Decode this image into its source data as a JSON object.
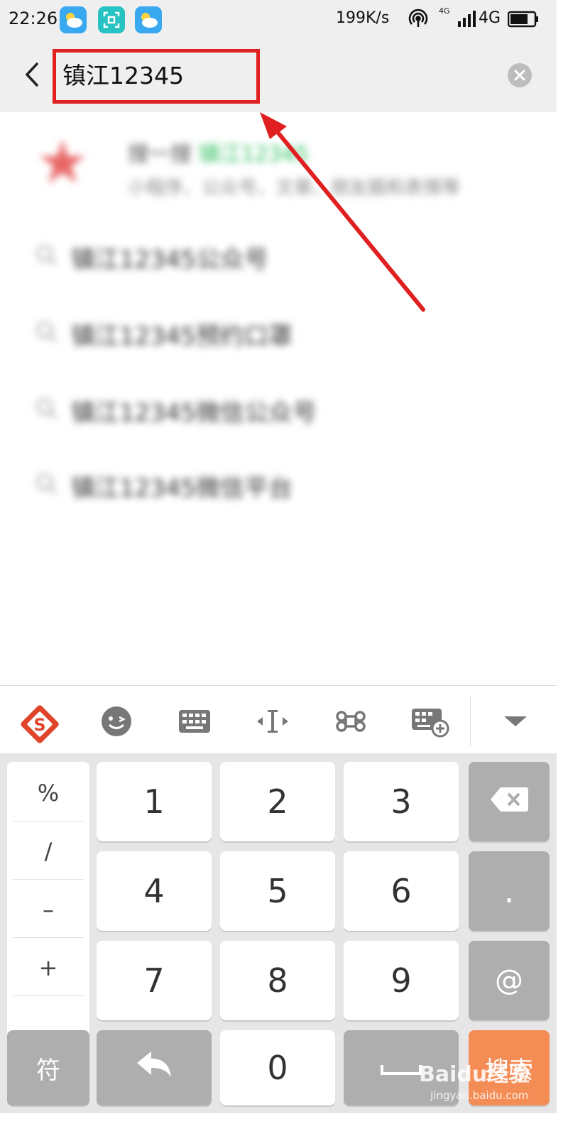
{
  "status_bar": {
    "time": "22:26",
    "network_speed": "199K/s",
    "network_small": "4G",
    "network_type": "4G"
  },
  "search": {
    "query": "镇江12345"
  },
  "suggestions": {
    "top_title_prefix": "搜一搜",
    "top_title_keyword": "镇江12345",
    "top_subtitle": "小程序、公众号、文章、朋友圈和表情等",
    "items": [
      "镇江12345公众号",
      "镇江12345预约口罩",
      "镇江12345微信公众号",
      "镇江12345微信平台"
    ]
  },
  "keyboard": {
    "symbols": [
      "%",
      "/",
      "–",
      "+"
    ],
    "digits": [
      "1",
      "2",
      "3",
      "4",
      "5",
      "6",
      "7",
      "8",
      "9",
      "0"
    ],
    "dot": ".",
    "at": "@",
    "symbol_key": "符",
    "search_key": "搜索"
  },
  "watermark": {
    "brand": "Baidu经验",
    "url": "jingyan.baidu.com"
  },
  "colors": {
    "annotation_red": "#e02020",
    "keyword_green": "#2fbf5f",
    "search_key_orange": "#f48c55"
  }
}
